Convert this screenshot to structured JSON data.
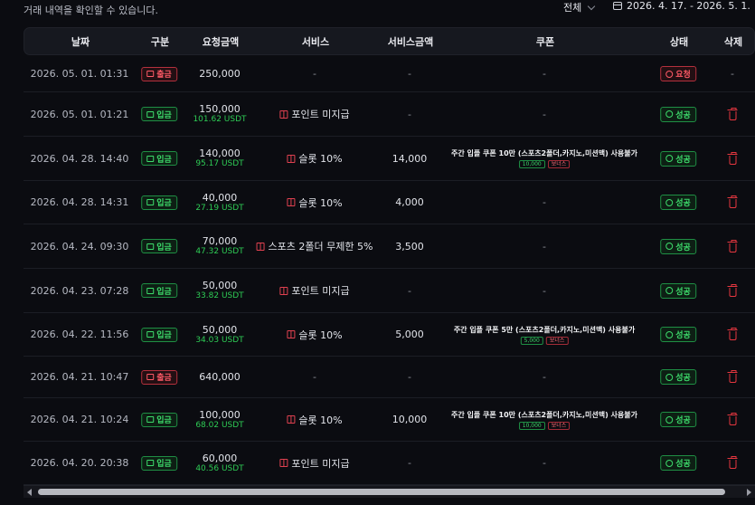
{
  "header": {
    "caption": "거래 내역을 확인할 수 있습니다.",
    "filter_label": "전체",
    "date_range": "2026. 4. 17. - 2026. 5. 1."
  },
  "columns": [
    "날짜",
    "구분",
    "요청금액",
    "서비스",
    "서비스금액",
    "쿠폰",
    "상태",
    "삭제"
  ],
  "rows": [
    {
      "date": "2026. 05. 01. 01:31",
      "type": "출금",
      "type_kind": "out",
      "amount": "250,000",
      "usdt": "",
      "service": "-",
      "service_icon": "",
      "service_amount": "-",
      "coupon": "-",
      "coupon_tags": [],
      "status": "요청",
      "status_kind": "req",
      "delete": "-"
    },
    {
      "date": "2026. 05. 01. 01:21",
      "type": "입금",
      "type_kind": "in",
      "amount": "150,000",
      "usdt": "101.62 USDT",
      "service": "포인트 미지급",
      "service_icon": "gift-icon",
      "service_amount": "-",
      "coupon": "-",
      "coupon_tags": [],
      "status": "성공",
      "status_kind": "ok",
      "delete": "trash-icon"
    },
    {
      "date": "2026. 04. 28. 14:40",
      "type": "입금",
      "type_kind": "in",
      "amount": "140,000",
      "usdt": "95.17 USDT",
      "service": "슬롯 10%",
      "service_icon": "gift-icon",
      "service_amount": "14,000",
      "coupon": "주간 입플 쿠폰 10만 (스포츠2폴더,카지노,미션맥) 사용불가",
      "coupon_tags": [
        "10,000",
        "보너스"
      ],
      "status": "성공",
      "status_kind": "ok",
      "delete": "trash-icon"
    },
    {
      "date": "2026. 04. 28. 14:31",
      "type": "입금",
      "type_kind": "in",
      "amount": "40,000",
      "usdt": "27.19 USDT",
      "service": "슬롯 10%",
      "service_icon": "gift-icon",
      "service_amount": "4,000",
      "coupon": "-",
      "coupon_tags": [],
      "status": "성공",
      "status_kind": "ok",
      "delete": "trash-icon"
    },
    {
      "date": "2026. 04. 24. 09:30",
      "type": "입금",
      "type_kind": "in",
      "amount": "70,000",
      "usdt": "47.32 USDT",
      "service": "스포츠 2폴더 무제한 5%",
      "service_icon": "gift-icon",
      "service_amount": "3,500",
      "coupon": "-",
      "coupon_tags": [],
      "status": "성공",
      "status_kind": "ok",
      "delete": "trash-icon"
    },
    {
      "date": "2026. 04. 23. 07:28",
      "type": "입금",
      "type_kind": "in",
      "amount": "50,000",
      "usdt": "33.82 USDT",
      "service": "포인트 미지급",
      "service_icon": "gift-icon",
      "service_amount": "-",
      "coupon": "-",
      "coupon_tags": [],
      "status": "성공",
      "status_kind": "ok",
      "delete": "trash-icon"
    },
    {
      "date": "2026. 04. 22. 11:56",
      "type": "입금",
      "type_kind": "in",
      "amount": "50,000",
      "usdt": "34.03 USDT",
      "service": "슬롯 10%",
      "service_icon": "gift-icon",
      "service_amount": "5,000",
      "coupon": "주간 입플 쿠폰 5만 (스포츠2폴더,카지노,미션맥) 사용불가",
      "coupon_tags": [
        "5,000",
        "보너스"
      ],
      "status": "성공",
      "status_kind": "ok",
      "delete": "trash-icon"
    },
    {
      "date": "2026. 04. 21. 10:47",
      "type": "출금",
      "type_kind": "out",
      "amount": "640,000",
      "usdt": "",
      "service": "-",
      "service_icon": "",
      "service_amount": "-",
      "coupon": "-",
      "coupon_tags": [],
      "status": "성공",
      "status_kind": "ok",
      "delete": "trash-icon"
    },
    {
      "date": "2026. 04. 21. 10:24",
      "type": "입금",
      "type_kind": "in",
      "amount": "100,000",
      "usdt": "68.02 USDT",
      "service": "슬롯 10%",
      "service_icon": "gift-icon",
      "service_amount": "10,000",
      "coupon": "주간 입플 쿠폰 10만 (스포츠2폴더,카지노,미션맥) 사용불가",
      "coupon_tags": [
        "10,000",
        "보너스"
      ],
      "status": "성공",
      "status_kind": "ok",
      "delete": "trash-icon"
    },
    {
      "date": "2026. 04. 20. 20:38",
      "type": "입금",
      "type_kind": "in",
      "amount": "60,000",
      "usdt": "40.56 USDT",
      "service": "포인트 미지급",
      "service_icon": "gift-icon",
      "service_amount": "-",
      "coupon": "-",
      "coupon_tags": [],
      "status": "성공",
      "status_kind": "ok",
      "delete": "trash-icon"
    }
  ]
}
